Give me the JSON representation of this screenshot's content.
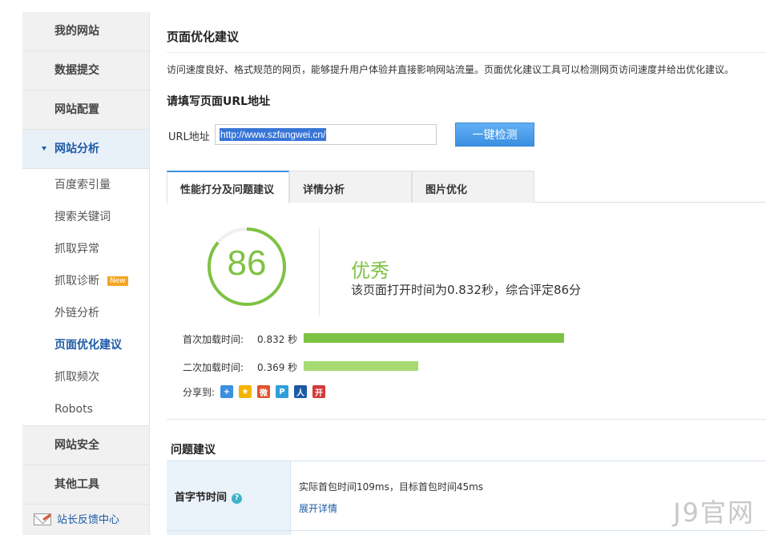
{
  "sidebar": {
    "my_site": "我的网站",
    "data_submit": "数据提交",
    "site_config": "网站配置",
    "site_analysis": "网站分析",
    "sub_items": [
      {
        "label": "百度索引量"
      },
      {
        "label": "搜索关键词"
      },
      {
        "label": "抓取异常"
      },
      {
        "label": "抓取诊断",
        "badge": "New"
      },
      {
        "label": "外链分析"
      },
      {
        "label": "页面优化建议"
      },
      {
        "label": "抓取频次"
      },
      {
        "label": "Robots"
      }
    ],
    "site_security": "网站安全",
    "other_tools": "其他工具",
    "feedback": "站长反馈中心"
  },
  "main": {
    "title": "页面优化建议",
    "intro": "访问速度良好、格式规范的网页，能够提升用户体验并直接影响网站流量。页面优化建议工具可以检测网页访问速度并给出优化建议。",
    "url_heading": "请填写页面URL地址",
    "url_label": "URL地址",
    "url_value": "http://www.szfangwei.cn/",
    "check_button": "一键检测",
    "tabs": [
      "性能打分及问题建议",
      "详情分析",
      "图片优化"
    ]
  },
  "score": {
    "value": "86",
    "fraction": 0.86,
    "grade": "优秀",
    "summary": "该页面打开时间为0.832秒，综合评定86分",
    "ring_color": "#7ec243"
  },
  "metrics": [
    {
      "label": "首次加载时间:",
      "value": "0.832 秒",
      "fraction": 1.0,
      "color": "#7ec243"
    },
    {
      "label": "二次加载时间:",
      "value": "0.369 秒",
      "fraction": 0.44,
      "color": "#a6db72"
    }
  ],
  "share": {
    "label": "分享到:",
    "icons": [
      {
        "name": "share-plus-icon",
        "glyph": "+",
        "color": "#3b8fe0"
      },
      {
        "name": "qzone-icon",
        "glyph": "★",
        "color": "#f5b400"
      },
      {
        "name": "weibo-icon",
        "glyph": "微",
        "color": "#e0542e"
      },
      {
        "name": "tencent-weibo-icon",
        "glyph": "P",
        "color": "#2e9fd8"
      },
      {
        "name": "renren-icon",
        "glyph": "人",
        "color": "#1c5aa6"
      },
      {
        "name": "kaixin-icon",
        "glyph": "开",
        "color": "#d23a3a"
      }
    ]
  },
  "issues": {
    "title": "问题建议",
    "items": [
      {
        "name": "首字节时间",
        "desc": "实际首包时间109ms，目标首包时间45ms",
        "link": "展开详情"
      }
    ]
  },
  "watermark": "J9官网"
}
